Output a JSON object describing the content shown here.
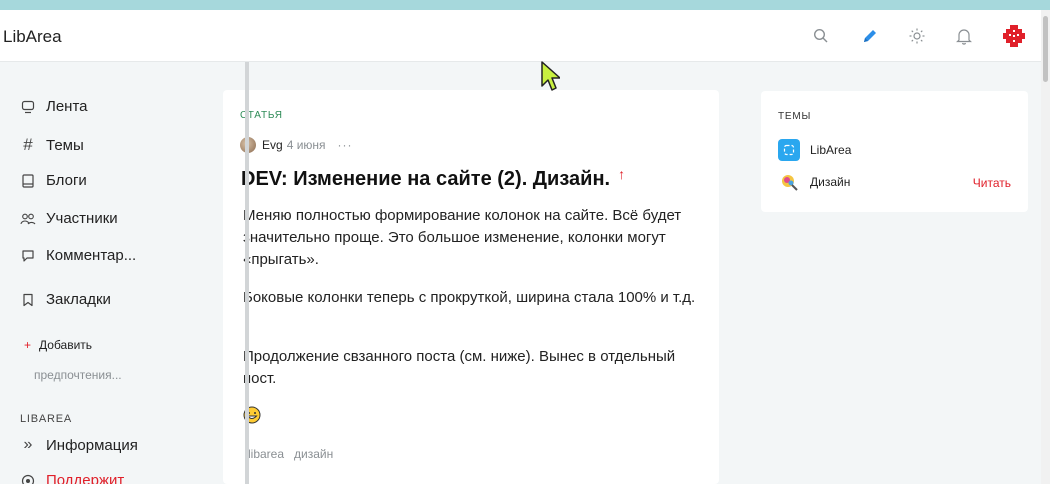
{
  "app": {
    "logo": "LibArea"
  },
  "header_icons": [
    "search-icon",
    "pencil-icon",
    "sun-icon",
    "bell-icon",
    "avatar"
  ],
  "colors": {
    "accent": "#2b8ee8",
    "brand_red": "#e0202a",
    "category_green": "#2e8b57",
    "topstrip": "#a6d8dc"
  },
  "sidebar": {
    "items": [
      {
        "icon": "feed-icon",
        "label": "Лента"
      },
      {
        "icon": "hash-icon",
        "label": "Темы"
      },
      {
        "icon": "blog-icon",
        "label": "Блоги"
      },
      {
        "icon": "users-icon",
        "label": "Участники"
      },
      {
        "icon": "comment-icon",
        "label": "Комментар..."
      },
      {
        "icon": "bookmark-icon",
        "label": "Закладки"
      }
    ],
    "add": {
      "plus": "+",
      "label": "Добавить"
    },
    "preferences": "предпочтения...",
    "section_title": "LIBAREA",
    "info": "Информация",
    "support": "Поддержит"
  },
  "post": {
    "category": "СТАТЬЯ",
    "author": "Evg",
    "date": "4 июня",
    "dots": "···",
    "title": "DEV: Изменение на сайте (2). Дизайн.",
    "vote_arrow": "↑",
    "paragraphs": [
      "Меняю полностью формирование колонок на сайте. Всё будет значительно проще. Это большое изменение, колонки могут «прыгать».",
      "Боковые колонки теперь с прокруткой, ширина стала 100% и т.д.",
      "Продолжение свзанного поста (см. ниже). Вынес в отдельный пост."
    ],
    "tags": [
      "libarea",
      "дизайн"
    ]
  },
  "topics": {
    "title": "ТЕМЫ",
    "items": [
      {
        "icon": "libarea-topic-icon",
        "label": "LibArea"
      },
      {
        "icon": "design-topic-icon",
        "label": "Дизайн"
      }
    ],
    "read_label": "Читать"
  }
}
